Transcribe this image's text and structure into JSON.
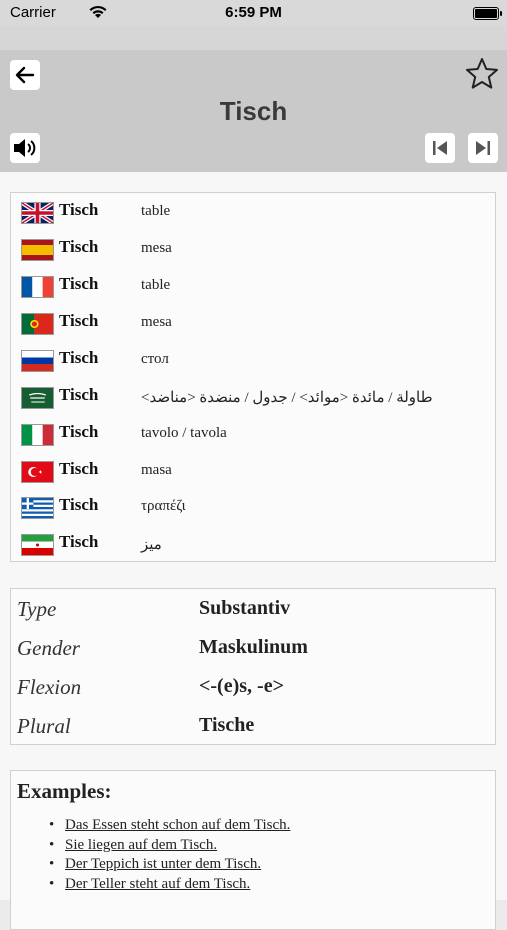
{
  "status": {
    "carrier": "Carrier",
    "time": "6:59 PM"
  },
  "header": {
    "title": "Tisch"
  },
  "translations": [
    {
      "flag": "uk-flag",
      "word": "Tisch",
      "translation": "table"
    },
    {
      "flag": "spain-flag",
      "word": "Tisch",
      "translation": "mesa"
    },
    {
      "flag": "france-flag",
      "word": "Tisch",
      "translation": "table"
    },
    {
      "flag": "portugal-flag",
      "word": "Tisch",
      "translation": "mesa"
    },
    {
      "flag": "russia-flag",
      "word": "Tisch",
      "translation": "стол"
    },
    {
      "flag": "saudi-flag",
      "word": "Tisch",
      "translation": "<طاولة / مائدة <موائد> / جدول / منضدة <مناضد"
    },
    {
      "flag": "italy-flag",
      "word": "Tisch",
      "translation": "tavolo / tavola"
    },
    {
      "flag": "turkey-flag",
      "word": "Tisch",
      "translation": "masa"
    },
    {
      "flag": "greece-flag",
      "word": "Tisch",
      "translation": "τραπέζι"
    },
    {
      "flag": "iran-flag",
      "word": "Tisch",
      "translation": "میز"
    }
  ],
  "grammar": [
    {
      "label": "Type",
      "value": "Substantiv"
    },
    {
      "label": "Gender",
      "value": "Maskulinum"
    },
    {
      "label": "Flexion",
      "value": "<-(e)s, -e>"
    },
    {
      "label": "Plural",
      "value": "Tische"
    }
  ],
  "examples": {
    "title": "Examples:",
    "items": [
      "Das Essen steht schon auf dem Tisch.",
      "Sie liegen auf dem Tisch.",
      "Der Teppich ist unter dem Tisch.",
      "Der Teller steht auf dem Tisch."
    ]
  }
}
